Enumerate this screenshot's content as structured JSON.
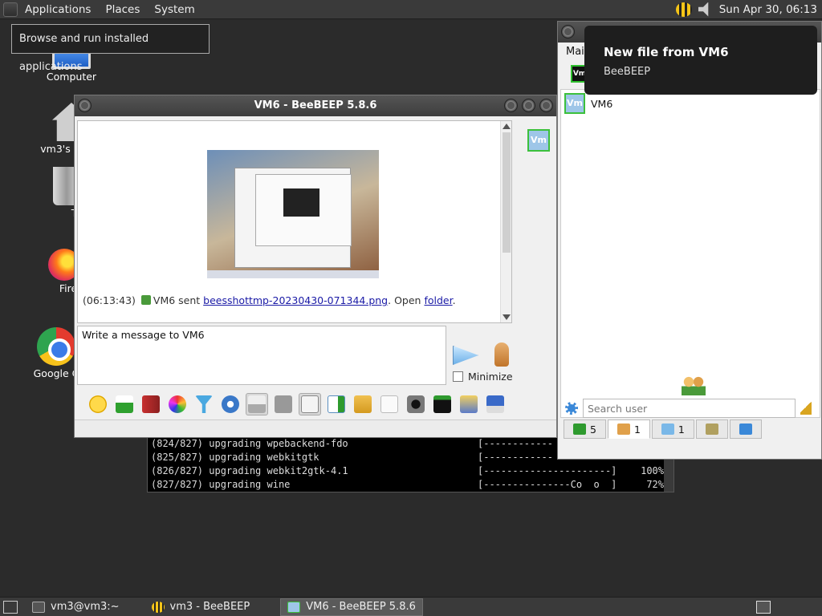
{
  "top_panel": {
    "menus": [
      "Applications",
      "Places",
      "System"
    ],
    "clock": "Sun Apr 30, 06:13"
  },
  "tooltip": {
    "text": "Browse and run installed applications"
  },
  "desktop_icons": [
    {
      "label": "Computer",
      "icon": "computer-icon"
    },
    {
      "label": "vm3's",
      "icon": "home-folder-icon"
    },
    {
      "label": "Tra",
      "icon": "trash-icon"
    },
    {
      "label": "Fire",
      "icon": "firefox-icon"
    },
    {
      "label": "Google C",
      "icon": "chrome-icon"
    }
  ],
  "terminal": {
    "lines": [
      {
        "pkg": "(824/827) upgrading wpebackend-fdo",
        "bar": "[------------",
        "pct": ""
      },
      {
        "pkg": "(825/827) upgrading webkitgtk",
        "bar": "[------------",
        "pct": ""
      },
      {
        "pkg": "(826/827) upgrading webkit2gtk-4.1",
        "bar": "[----------------------]",
        "pct": "100%"
      },
      {
        "pkg": "(827/827) upgrading wine",
        "bar": "[---------------Co  o  ]",
        "pct": "72%"
      }
    ]
  },
  "chat_window": {
    "title": "VM6 - BeeBEEP 5.8.6",
    "avatar_label": "Vm",
    "message": {
      "time": "(06:13:43)",
      "sender_text": "VM6 sent",
      "file_link": "beesshottmp-20230430-071344.png",
      "open_text": ". Open",
      "folder_link": "folder",
      "end": "."
    },
    "input_value": "Write a message to VM6",
    "minimize_label": "Minimize",
    "toolbar_icons": [
      "emoticons-icon",
      "download-icon",
      "font-icon",
      "color-picker-icon",
      "filter-icon",
      "settings-icon",
      "mail-tray-icon",
      "text-style-icon",
      "music-note-icon",
      "send-file-icon",
      "folder-share-icon",
      "code-icon",
      "screenshot-icon",
      "terminal-icon",
      "notes-icon",
      "save-icon"
    ]
  },
  "main_window": {
    "menu_label": "Main",
    "toolbar_vm_label": "Vm",
    "users": [
      {
        "name": "VM6",
        "avatar_label": "Vm"
      }
    ],
    "search_placeholder": "Search user",
    "tabs": [
      {
        "count": "5",
        "icon": "users-count-icon"
      },
      {
        "count": "1",
        "icon": "people-icon"
      },
      {
        "count": "1",
        "icon": "chats-icon"
      },
      {
        "count": "",
        "icon": "groups-icon"
      },
      {
        "count": "",
        "icon": "files-icon"
      }
    ]
  },
  "notification": {
    "title": "New file from VM6",
    "body": "BeeBEEP"
  },
  "taskbar": {
    "tasks": [
      {
        "label": "vm3@vm3:~",
        "active": false
      },
      {
        "label": "vm3 - BeeBEEP",
        "active": false
      },
      {
        "label": "VM6 - BeeBEEP 5.8.6",
        "active": true
      }
    ]
  }
}
